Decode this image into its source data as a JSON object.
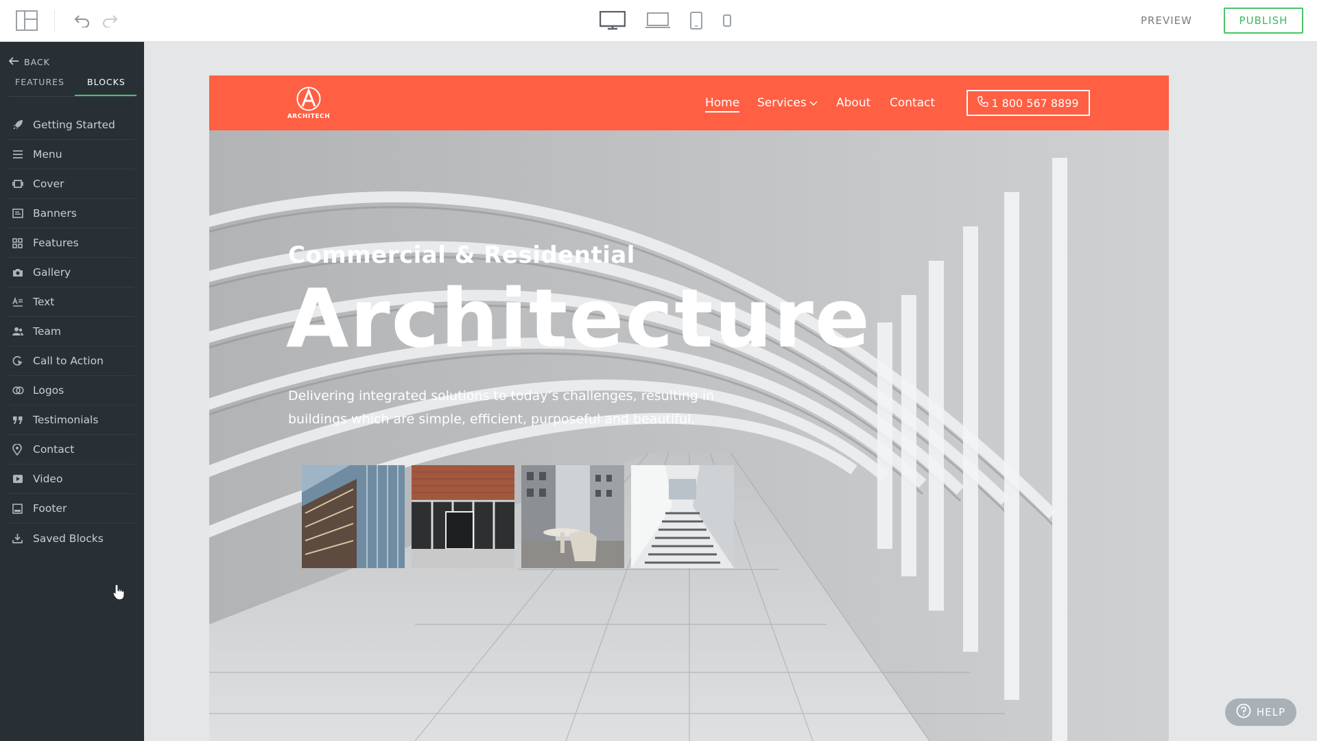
{
  "toolbar": {
    "preview_label": "PREVIEW",
    "publish_label": "PUBLISH",
    "icons": [
      "layout-icon",
      "undo-icon",
      "redo-icon",
      "desktop-icon",
      "laptop-icon",
      "tablet-icon",
      "mobile-icon"
    ]
  },
  "sidebar": {
    "back_label": "BACK",
    "tabs": [
      {
        "label": "FEATURES",
        "active": false
      },
      {
        "label": "BLOCKS",
        "active": true
      }
    ],
    "items": [
      {
        "label": "Getting Started",
        "icon": "rocket-icon"
      },
      {
        "label": "Menu",
        "icon": "menu-icon"
      },
      {
        "label": "Cover",
        "icon": "cover-icon"
      },
      {
        "label": "Banners",
        "icon": "banner-icon"
      },
      {
        "label": "Features",
        "icon": "grid-icon"
      },
      {
        "label": "Gallery",
        "icon": "camera-icon"
      },
      {
        "label": "Text",
        "icon": "text-icon"
      },
      {
        "label": "Team",
        "icon": "team-icon"
      },
      {
        "label": "Call to Action",
        "icon": "cta-icon"
      },
      {
        "label": "Logos",
        "icon": "logos-icon"
      },
      {
        "label": "Testimonials",
        "icon": "quote-icon"
      },
      {
        "label": "Contact",
        "icon": "pin-icon"
      },
      {
        "label": "Video",
        "icon": "video-icon"
      },
      {
        "label": "Footer",
        "icon": "footer-icon"
      },
      {
        "label": "Saved Blocks",
        "icon": "download-icon"
      }
    ]
  },
  "site": {
    "logo_text": "ARCHITECH",
    "nav": {
      "home": "Home",
      "services": "Services",
      "about": "About",
      "contact": "Contact",
      "phone": "1 800 567 8899"
    },
    "hero": {
      "subtitle": "Commercial & Residential",
      "title": "Architecture",
      "description": "Delivering integrated solutions to today’s challenges, resulting in buildings which are simple, efficient, purposeful and beautiful."
    }
  },
  "help_label": "HELP",
  "colors": {
    "accent_green": "#4cc26a",
    "sidebar_bg": "#283036",
    "site_nav_bg": "#ff5f43"
  }
}
